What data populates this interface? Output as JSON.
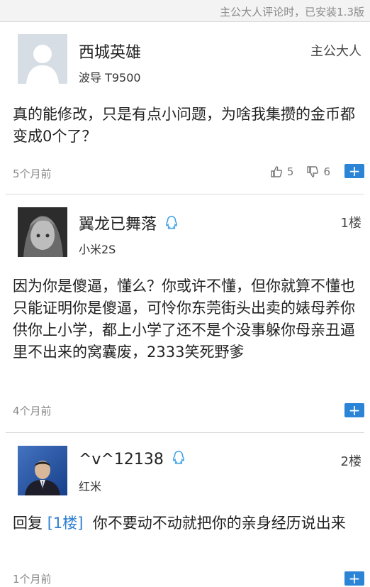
{
  "topbar": {
    "hint": "主公大人评论时，已安装1.3版"
  },
  "comments": [
    {
      "name": "西城英雄",
      "device": "波导 T9500",
      "floor": "主公大人",
      "content": "真的能修改，只是有点小问题，为啥我集攒的金币都变成0个了？",
      "time": "5个月前",
      "likes": "5",
      "dislikes": "6"
    },
    {
      "name": "翼龙已舞落",
      "device": "小米2S",
      "floor": "1楼",
      "content": "因为你是傻逼，懂么？你或许不懂，但你就算不懂也只能证明你是傻逼，可怜你东莞街头出卖的婊母养你供你上小学，都上小学了还不是个没事躲你母亲丑逼里不出来的窝囊废，2333笑死野爹",
      "time": "4个月前"
    },
    {
      "name": "^v^12138",
      "device": "红米",
      "floor": "2楼",
      "reply_ref": "[1楼]",
      "content_prefix": "回复",
      "content": "你不要动不动就把你的亲身经历说出来",
      "time": "1个月前"
    }
  ],
  "add_label": "+",
  "colors": {
    "accent": "#2b84d6",
    "reply_link": "#2f7fd1"
  }
}
